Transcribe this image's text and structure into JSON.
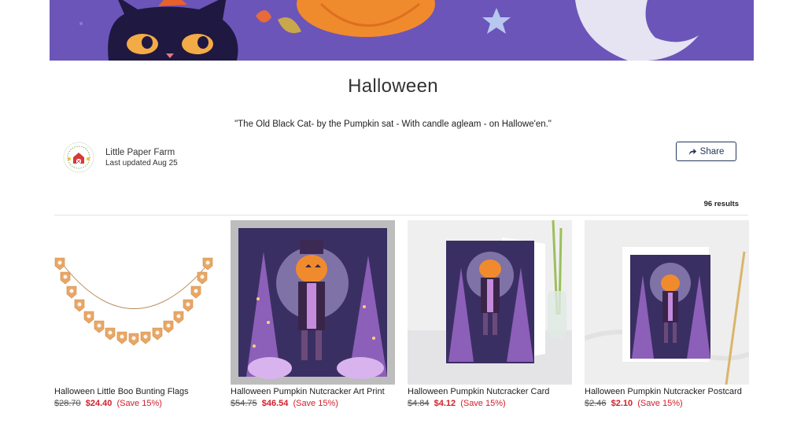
{
  "collection": {
    "title": "Halloween",
    "quote": "\"The Old Black Cat- by the Pumpkin sat - With candle agleam - on Hallowe'en.\""
  },
  "owner": {
    "name": "Little Paper Farm",
    "updated": "Last updated Aug 25"
  },
  "share": {
    "label": "Share"
  },
  "results": {
    "count_label": "96 results"
  },
  "products": [
    {
      "name": "Halloween Little Boo Bunting Flags",
      "old_price": "$28.70",
      "new_price": "$24.40",
      "save": "(Save 15%)"
    },
    {
      "name": "Halloween Pumpkin Nutcracker Art Print",
      "old_price": "$54.75",
      "new_price": "$46.54",
      "save": "(Save 15%)"
    },
    {
      "name": "Halloween Pumpkin Nutcracker Card",
      "old_price": "$4.84",
      "new_price": "$4.12",
      "save": "(Save 15%)"
    },
    {
      "name": "Halloween Pumpkin Nutcracker Postcard",
      "old_price": "$2.46",
      "new_price": "$2.10",
      "save": "(Save 15%)"
    }
  ],
  "colors": {
    "banner_purple": "#6b55b9",
    "sale_red": "#d21f2b",
    "button_navy": "#24385d"
  },
  "icons": [
    "share-arrow-icon",
    "shop-logo"
  ]
}
